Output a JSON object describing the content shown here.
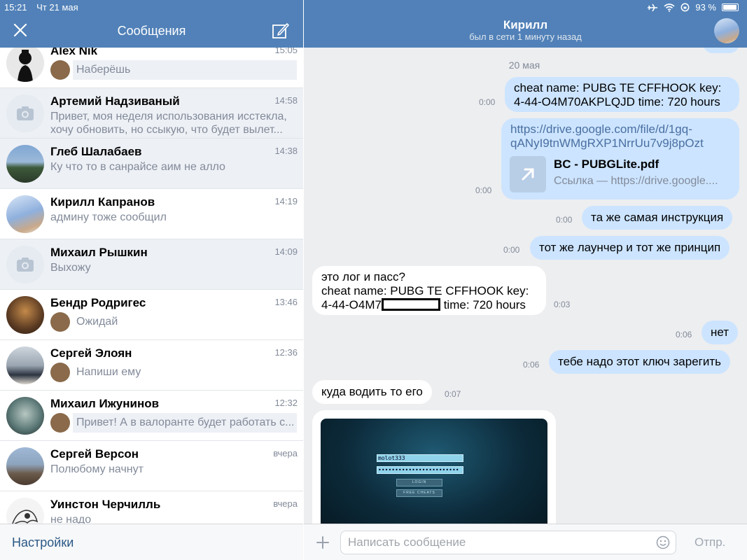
{
  "status_bar": {
    "time": "15:21",
    "date": "Чт 21 мая",
    "battery": "93 %"
  },
  "left_header": {
    "title": "Сообщения"
  },
  "dialogs": [
    {
      "name": "Alex Nik",
      "time": "15:05",
      "text": "Наберёшь",
      "own": true
    },
    {
      "name": "Артемий Надзиваный",
      "time": "14:58",
      "text": "Привет, моя неделя использования исстекла, хочу обновить, но ссыкую, что будет вылет..."
    },
    {
      "name": "Глеб Шалабаев",
      "time": "14:38",
      "text": "Ку что то в санрайсе аим не алло"
    },
    {
      "name": "Кирилл Капранов",
      "time": "14:19",
      "text": "админу тоже сообщил"
    },
    {
      "name": "Михаил Рышкин",
      "time": "14:09",
      "text": "Выхожу"
    },
    {
      "name": "Бендр Родригес",
      "time": "13:46",
      "text": "Ожидай",
      "own": true
    },
    {
      "name": "Сергей Элоян",
      "time": "12:36",
      "text": "Напиши ему",
      "own": true
    },
    {
      "name": "Михаил Ижунинов",
      "time": "12:32",
      "text": "Привет! А в валоранте будет работать с...",
      "own": true
    },
    {
      "name": "Сергей Версон",
      "time": "вчера",
      "text": "Полюбому начнут"
    },
    {
      "name": "Уинстон Черчилль",
      "time": "вчера",
      "text": "не надо"
    }
  ],
  "left_footer": {
    "settings": "Настройки"
  },
  "chat": {
    "title": "Кирилл",
    "status": "был в сети 1 минуту назад",
    "date_separator": "20 мая",
    "messages": [
      {
        "dir": "out",
        "time": "0:00",
        "lines": [
          "cheat name: PUBG TE CFFHOOK key:",
          "4-44-O4M70AKPLQJD time: 720 hours"
        ]
      },
      {
        "dir": "out",
        "time": "0:00",
        "link_lines": [
          "https://drive.google.com/file/d/1gq-",
          "qANyI9tnWMgRXP1NrrUu7v9j8pOzt"
        ],
        "attach_title": "BC - PUBGLite.pdf",
        "attach_sub": "Ссылка — https://drive.google...."
      },
      {
        "dir": "out",
        "time": "0:00",
        "text": "та же самая инструкция"
      },
      {
        "dir": "out",
        "time": "0:00",
        "text": "тот же лаунчер и тот же принцип"
      },
      {
        "dir": "in",
        "time": "0:03",
        "lines": [
          "это лог и пасс?",
          "cheat name: PUBG TE CFFHOOK key:"
        ],
        "line3_a": "4-44-O4M7",
        "line3_b": " time: 720 hours"
      },
      {
        "dir": "out",
        "time": "0:06",
        "text": "нет"
      },
      {
        "dir": "out",
        "time": "0:06",
        "text": "тебе надо этот ключ зарегить"
      },
      {
        "dir": "in",
        "time": "0:07",
        "text": "куда водить то его"
      }
    ],
    "image": {
      "login": "molot333",
      "password": "••••••••••••••••••••••••",
      "btn1": "LOGIN",
      "btn2": "FREE CHEATS"
    }
  },
  "composer": {
    "placeholder": "Написать сообщение",
    "send": "Отпр."
  },
  "colors": {
    "header": "#5181b8",
    "bubble_out": "#cce4ff",
    "bubble_in": "#ffffff",
    "chat_bg": "#edeef0"
  }
}
